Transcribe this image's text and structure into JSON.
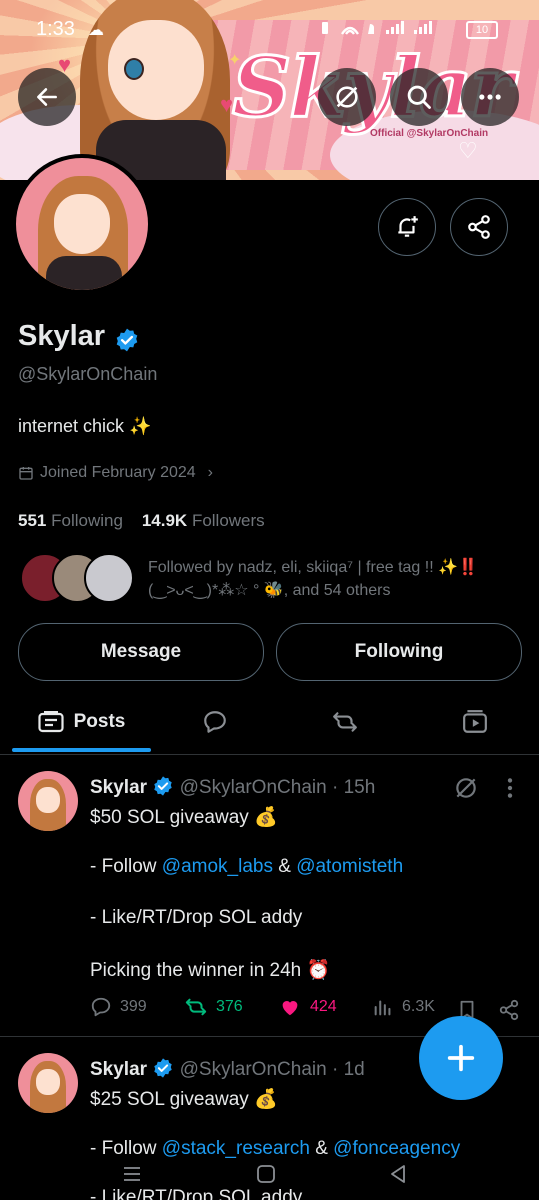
{
  "status_bar": {
    "time": "1:33",
    "battery": "10"
  },
  "banner": {
    "brand_text": "Skylar",
    "brand_subtext": "Official @SkylarOnChain"
  },
  "profile": {
    "name": "Skylar",
    "handle": "@SkylarOnChain",
    "bio": "internet chick ✨",
    "joined": "Joined February 2024",
    "following_count": "551",
    "following_label": "Following",
    "followers_count": "14.9K",
    "followers_label": "Followers",
    "followed_by": "Followed by nadz, eli, skiiqa⁷ | free tag !! ✨‼️ (‿>ᴗ<‿)*⁂☆ ° 🐝, and 54 others"
  },
  "buttons": {
    "message": "Message",
    "following": "Following"
  },
  "tabs": [
    {
      "label": "Posts",
      "icon": "posts-icon"
    },
    {
      "icon": "replies-icon"
    },
    {
      "icon": "repost-icon"
    },
    {
      "icon": "media-icon"
    }
  ],
  "posts": [
    {
      "name": "Skylar",
      "handle": "@SkylarOnChain",
      "time": "· 15h",
      "line1": "$50 SOL giveaway 💰",
      "line2_pre": "- Follow ",
      "mention1": "@amok_labs",
      "amp": " & ",
      "mention2": "@atomisteth",
      "line3": "- Like/RT/Drop SOL addy",
      "line4": "Picking the winner in 24h ⏰",
      "replies": "399",
      "reposts": "376",
      "likes": "424",
      "views": "6.3K"
    },
    {
      "name": "Skylar",
      "handle": "@SkylarOnChain",
      "time": "· 1d",
      "line1": "$25 SOL giveaway 💰",
      "line2_pre": "- Follow ",
      "mention1": "@stack_research",
      "amp": " & ",
      "mention2": "@fonceagency",
      "line3": "- Like/RT/Drop SOL addy"
    }
  ],
  "colors": {
    "accent": "#1d9bf0",
    "repost": "#00ba7c",
    "like": "#f91880",
    "muted": "#71767b"
  }
}
